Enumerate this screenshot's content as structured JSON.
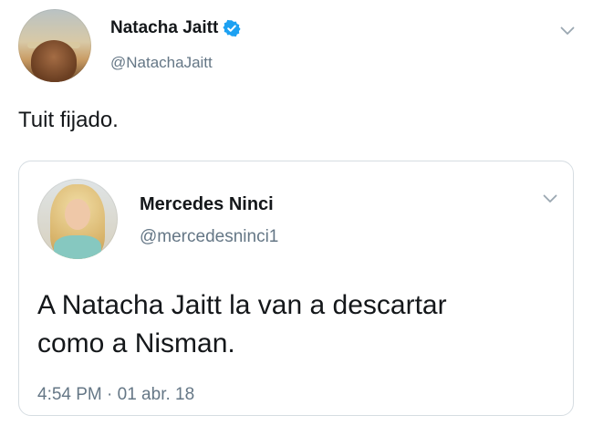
{
  "tweet": {
    "author": {
      "display_name": "Natacha Jaitt",
      "handle": "@NatachaJaitt",
      "verified": true
    },
    "text": "Tuit fijado.",
    "icons": {
      "verified": "verified-badge-icon",
      "menu": "chevron-down-icon"
    }
  },
  "quoted_tweet": {
    "author": {
      "display_name": "Mercedes Ninci",
      "handle": "@mercedesninci1"
    },
    "text_lines": [
      "A Natacha Jaitt la van a descartar",
      "como a Nisman."
    ],
    "timestamp": "4:54 PM · 01 abr. 18"
  },
  "colors": {
    "text_primary": "#14171a",
    "text_secondary": "#657786",
    "verified_blue": "#1da1f2",
    "card_border": "#d6dde2"
  }
}
